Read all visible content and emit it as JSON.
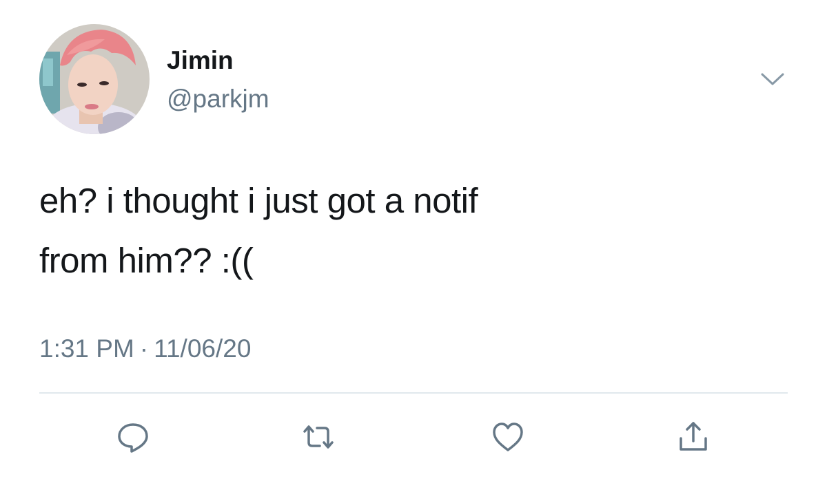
{
  "tweet": {
    "author": {
      "name": "Jimin",
      "handle": "@parkjm"
    },
    "text_lines": [
      "eh? i thought i just got a notif",
      "from him?? :(("
    ],
    "time": "1:31 PM",
    "separator": "·",
    "date": "11/06/20"
  },
  "icons": {
    "menu": "chevron-down-icon",
    "reply": "reply-bubble-icon",
    "retweet": "retweet-icon",
    "like": "heart-icon",
    "share": "share-icon"
  },
  "colors": {
    "text": "#14171a",
    "secondary": "#657786",
    "divider": "#e1e8ed",
    "avatar_hair": "#e9858a"
  }
}
